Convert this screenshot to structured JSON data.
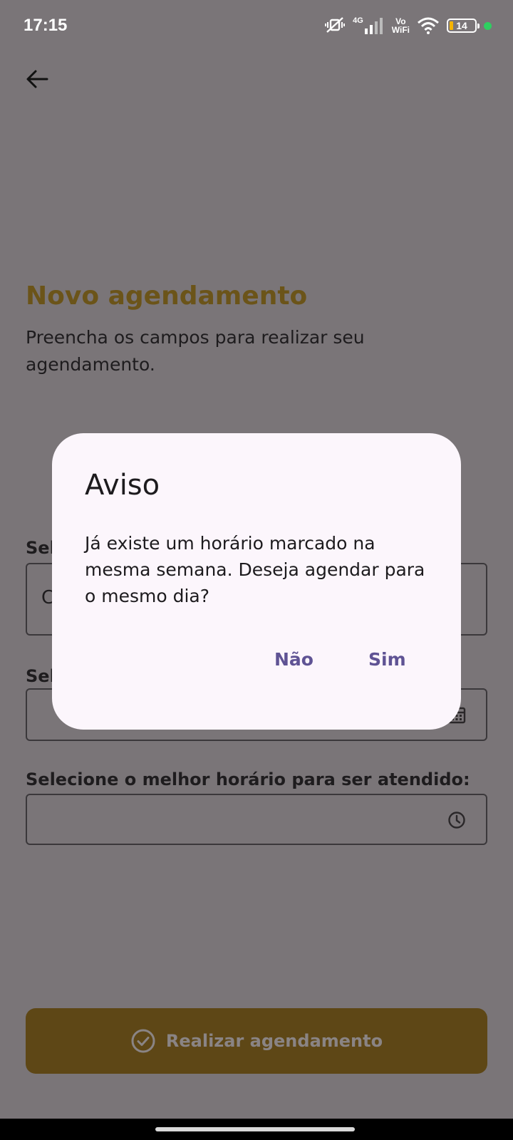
{
  "status_bar": {
    "time": "17:15",
    "network": "4G",
    "vowifi_line1": "Vo",
    "vowifi_line2": "WiFi",
    "battery_level": "14",
    "dot_color": "#2ed060"
  },
  "page": {
    "title": "Novo agendamento",
    "subtitle": "Preencha os campos para realizar seu agendamento.",
    "field1": {
      "label_visible": "Sel",
      "value_visible": "C"
    },
    "field2": {
      "label_visible": "Sel",
      "icon": "calendar-icon"
    },
    "field3": {
      "label": "Selecione o melhor horário para ser atendido:",
      "icon": "clock-icon"
    },
    "submit_label": "Realizar agendamento"
  },
  "dialog": {
    "title": "Aviso",
    "message": "Já existe um horário marcado na mesma semana. Deseja agendar para o mesmo dia?",
    "no_label": "Não",
    "yes_label": "Sim"
  },
  "colors": {
    "accent": "#6b5419",
    "dialog_button": "#5f5394",
    "scrim": "#7a7578",
    "dialog_bg": "#fcf6fc"
  }
}
